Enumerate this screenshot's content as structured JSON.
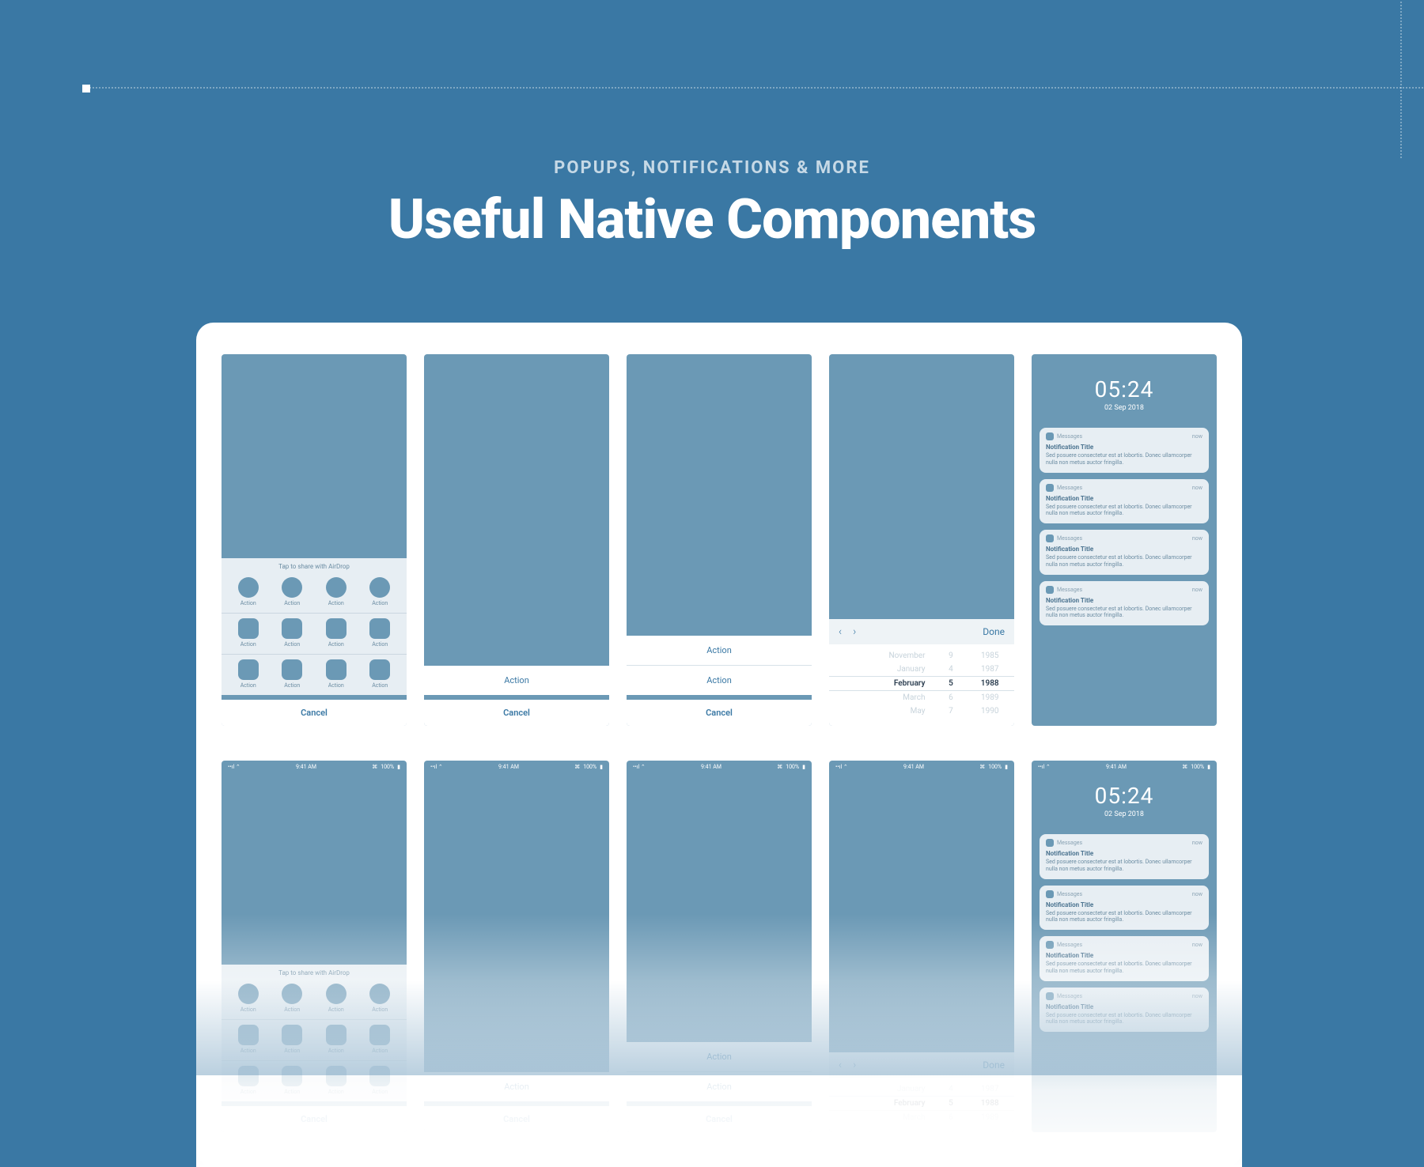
{
  "header": {
    "kicker": "POPUPS, NOTIFICATIONS & MORE",
    "title": "Useful Native Components"
  },
  "share": {
    "header": "Tap to share with AirDrop",
    "item_label": "Action",
    "cancel": "Cancel"
  },
  "action_sheet": {
    "actions": [
      "Action",
      "Action"
    ],
    "cancel": "Cancel"
  },
  "picker": {
    "done": "Done",
    "rows": [
      {
        "m": "November",
        "d": "9",
        "y": "1985"
      },
      {
        "m": "January",
        "d": "4",
        "y": "1987"
      },
      {
        "m": "February",
        "d": "5",
        "y": "1988"
      },
      {
        "m": "March",
        "d": "6",
        "y": "1989"
      },
      {
        "m": "May",
        "d": "7",
        "y": "1990"
      }
    ],
    "selected_index": 2
  },
  "lock": {
    "time": "05:24",
    "date": "02 Sep 2018",
    "app": "Messages",
    "meta": "now",
    "title": "Notification Title",
    "body": "Sed posuere consectetur est at lobortis. Donec ullamcorper nulla non metus auctor fringilla."
  },
  "status": {
    "time": "9:41 AM",
    "battery": "100%",
    "bt": "$"
  }
}
